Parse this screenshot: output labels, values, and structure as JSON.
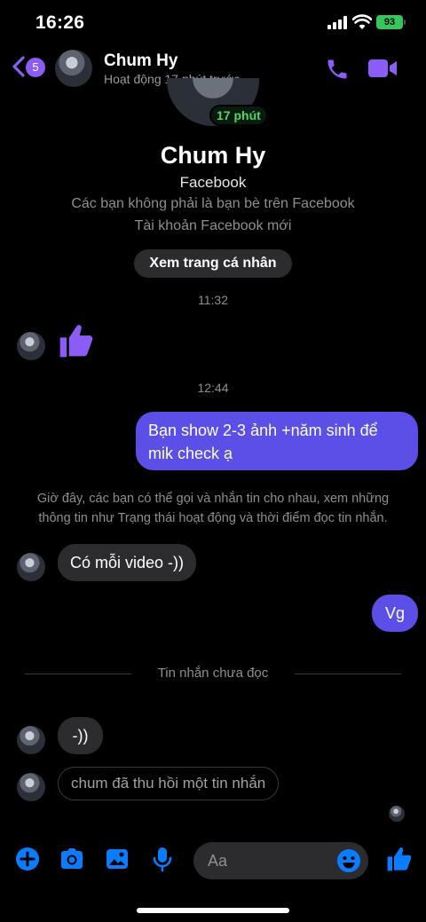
{
  "status_bar": {
    "time": "16:26",
    "battery": "93"
  },
  "header": {
    "unread_count": "5",
    "contact_name": "Chum Hy",
    "contact_status": "Hoạt động 17 phút trước"
  },
  "profile": {
    "active_badge": "17 phút",
    "name": "Chum Hy",
    "source": "Facebook",
    "note_line1": "Các bạn không phải là bạn bè trên Facebook",
    "note_line2": "Tài khoản Facebook mới",
    "view_profile_label": "Xem trang cá nhân"
  },
  "messages": {
    "timestamp1": "11:32",
    "timestamp2": "12:44",
    "outgoing1": "Bạn show 2-3 ảnh +năm sinh để mik check ạ",
    "system_line1": "Giờ đây, các bạn có thể gọi và nhắn tin cho nhau, xem những",
    "system_line2": "thông tin như Trạng thái hoạt động và thời điểm đọc tin nhắn.",
    "incoming1": "Có mỗi video -))",
    "outgoing2": "Vg",
    "unread_divider": "Tin nhắn chưa đọc",
    "incoming2": "-))",
    "recalled": "chum đã thu hồi một tin nhắn"
  },
  "composer": {
    "placeholder": "Aa"
  },
  "colors": {
    "accent": "#8b5cf6",
    "outgoing_bubble": "#5b4fe8",
    "icon_blue": "#0a7cff",
    "active_green": "#4cd964"
  }
}
